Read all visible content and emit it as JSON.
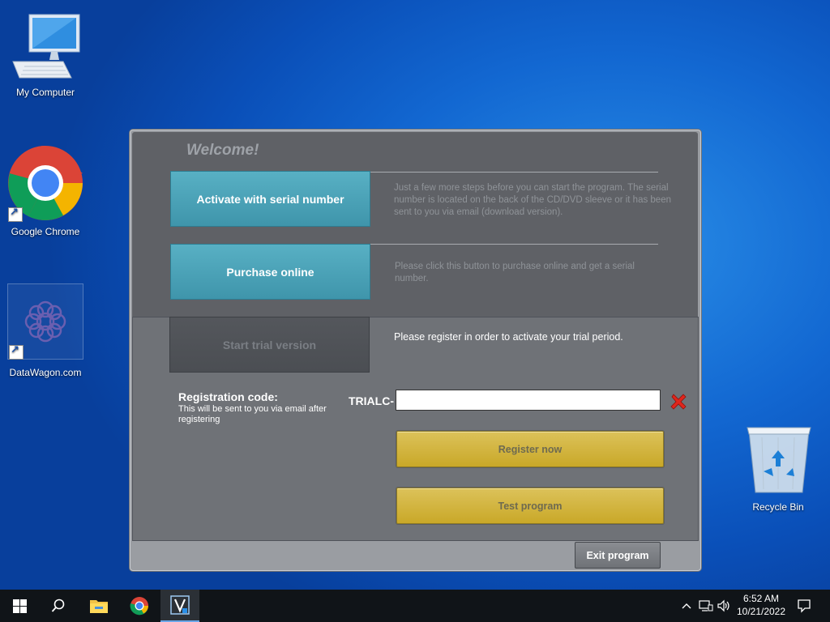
{
  "desktop": {
    "icons": [
      {
        "label": "My Computer"
      },
      {
        "label": "Google Chrome"
      },
      {
        "label": "DataWagon.com"
      },
      {
        "label": "Recycle Bin"
      }
    ]
  },
  "dialog": {
    "welcome": "Welcome!",
    "activate_button": "Activate with serial number",
    "activate_desc": "Just a few more steps before you can start the program. The serial number is located on the back of the CD/DVD sleeve or it has been sent to you via email (download version).",
    "purchase_button": "Purchase online",
    "purchase_desc": "Please click this button to purchase online and get a serial number.",
    "trial_button": "Start trial version",
    "trial_desc": "Please register in order to activate your trial period.",
    "registration_title": "Registration code:",
    "registration_sub": "This will be sent to you via email after registering",
    "code_prefix": "TRIALC-",
    "code_value": "",
    "register_button": "Register now",
    "test_button": "Test program",
    "exit_button": "Exit program"
  },
  "taskbar": {
    "time": "6:52 AM",
    "date": "10/21/2022",
    "apps": [
      "start-icon",
      "search-icon",
      "file-explorer-icon",
      "chrome-icon",
      "vipre-app-icon"
    ],
    "tray": [
      "chevron-up-icon",
      "network-icon",
      "speaker-icon",
      "notification-icon"
    ]
  },
  "colors": {
    "teal_button": "#4aa3b8",
    "gold_button": "#d4b53e",
    "dialog_dark": "#5f6166",
    "dialog_light": "#6f7277",
    "desktop_blue": "#1267d1"
  }
}
